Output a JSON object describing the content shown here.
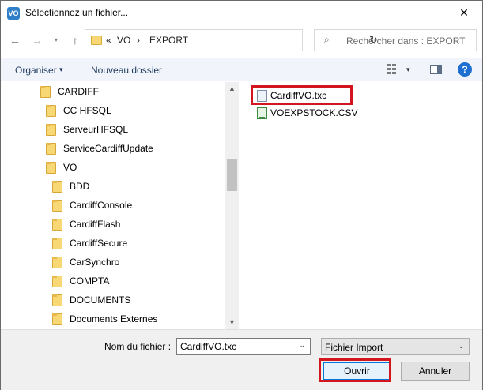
{
  "window": {
    "title": "Sélectionnez un fichier...",
    "close_glyph": "✕",
    "app_icon_text": "VO"
  },
  "nav": {
    "back_glyph": "←",
    "forward_glyph": "→",
    "recent_glyph": "▾",
    "up_glyph": "↑",
    "breadcrumb": [
      "VO",
      "EXPORT"
    ],
    "overflow_glyph": "«",
    "separator_glyph": "›",
    "refresh_glyph": "↻",
    "search_placeholder": "Rechercher dans : EXPORT"
  },
  "toolbar": {
    "organize_label": "Organiser",
    "organize_caret": "▾",
    "new_folder_label": "Nouveau dossier",
    "view_caret": "▾",
    "help_glyph": "?"
  },
  "tree": {
    "items": [
      {
        "label": "CARDIFF",
        "level": 0
      },
      {
        "label": "CC HFSQL",
        "level": 1
      },
      {
        "label": "ServeurHFSQL",
        "level": 1
      },
      {
        "label": "ServiceCardiffUpdate",
        "level": 1
      },
      {
        "label": "VO",
        "level": 1
      },
      {
        "label": "BDD",
        "level": 2
      },
      {
        "label": "CardiffConsole",
        "level": 2
      },
      {
        "label": "CardiffFlash",
        "level": 2
      },
      {
        "label": "CardiffSecure",
        "level": 2
      },
      {
        "label": "CarSynchro",
        "level": 2
      },
      {
        "label": "COMPTA",
        "level": 2
      },
      {
        "label": "DOCUMENTS",
        "level": 2
      },
      {
        "label": "Documents Externes",
        "level": 2
      }
    ],
    "scroll_up_glyph": "▲",
    "scroll_down_glyph": "▼"
  },
  "files": [
    {
      "name": "CardiffVO.txc",
      "type": "txc",
      "highlighted": true
    },
    {
      "name": "VOEXPSTOCK.CSV",
      "type": "csv",
      "highlighted": false
    }
  ],
  "footer": {
    "filename_label": "Nom du fichier :",
    "filename_value": "CardiffVO.txc",
    "filename_caret": "⌄",
    "filetype_value": "Fichier Import",
    "filetype_caret": "⌄",
    "open_label": "Ouvrir",
    "cancel_label": "Annuler"
  },
  "colors": {
    "highlight": "#d4141f",
    "accent": "#0078d7",
    "toolbar_bg": "#f1f5fb",
    "folder": "#f8d775"
  }
}
